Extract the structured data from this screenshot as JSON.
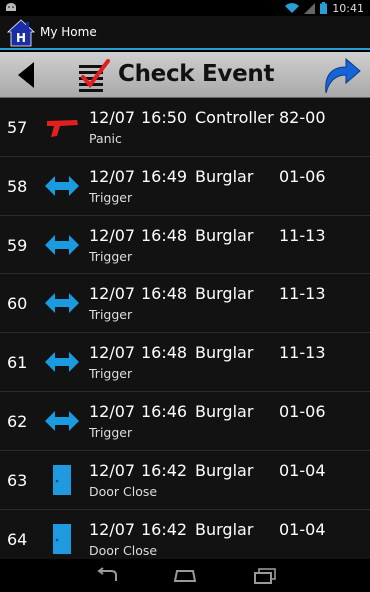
{
  "status": {
    "time": "10:41"
  },
  "app": {
    "title": "My Home",
    "icon_letter": "H"
  },
  "toolbar": {
    "title": "Check Event",
    "back": "back-arrow-icon",
    "refresh": "refresh-arrow-icon"
  },
  "colors": {
    "accent": "#2a9fd6",
    "arrow_blue": "#1a9be0",
    "panic_red": "#e0201c",
    "door_blue": "#1f9ae0"
  },
  "events": [
    {
      "idx": "57",
      "icon": "panic-gun-icon",
      "date": "12/07",
      "time": "16:50",
      "type": "Controller",
      "zone": "82-00",
      "desc": "Panic"
    },
    {
      "idx": "58",
      "icon": "trigger-arrow-icon",
      "date": "12/07",
      "time": "16:49",
      "type": "Burglar",
      "zone": "01-06",
      "desc": "Trigger"
    },
    {
      "idx": "59",
      "icon": "trigger-arrow-icon",
      "date": "12/07",
      "time": "16:48",
      "type": "Burglar",
      "zone": "11-13",
      "desc": "Trigger"
    },
    {
      "idx": "60",
      "icon": "trigger-arrow-icon",
      "date": "12/07",
      "time": "16:48",
      "type": "Burglar",
      "zone": "11-13",
      "desc": "Trigger"
    },
    {
      "idx": "61",
      "icon": "trigger-arrow-icon",
      "date": "12/07",
      "time": "16:48",
      "type": "Burglar",
      "zone": "11-13",
      "desc": "Trigger"
    },
    {
      "idx": "62",
      "icon": "trigger-arrow-icon",
      "date": "12/07",
      "time": "16:46",
      "type": "Burglar",
      "zone": "01-06",
      "desc": "Trigger"
    },
    {
      "idx": "63",
      "icon": "door-close-icon",
      "date": "12/07",
      "time": "16:42",
      "type": "Burglar",
      "zone": "01-04",
      "desc": "Door Close"
    },
    {
      "idx": "64",
      "icon": "door-close-icon",
      "date": "12/07",
      "time": "16:42",
      "type": "Burglar",
      "zone": "01-04",
      "desc": "Door Close"
    }
  ]
}
